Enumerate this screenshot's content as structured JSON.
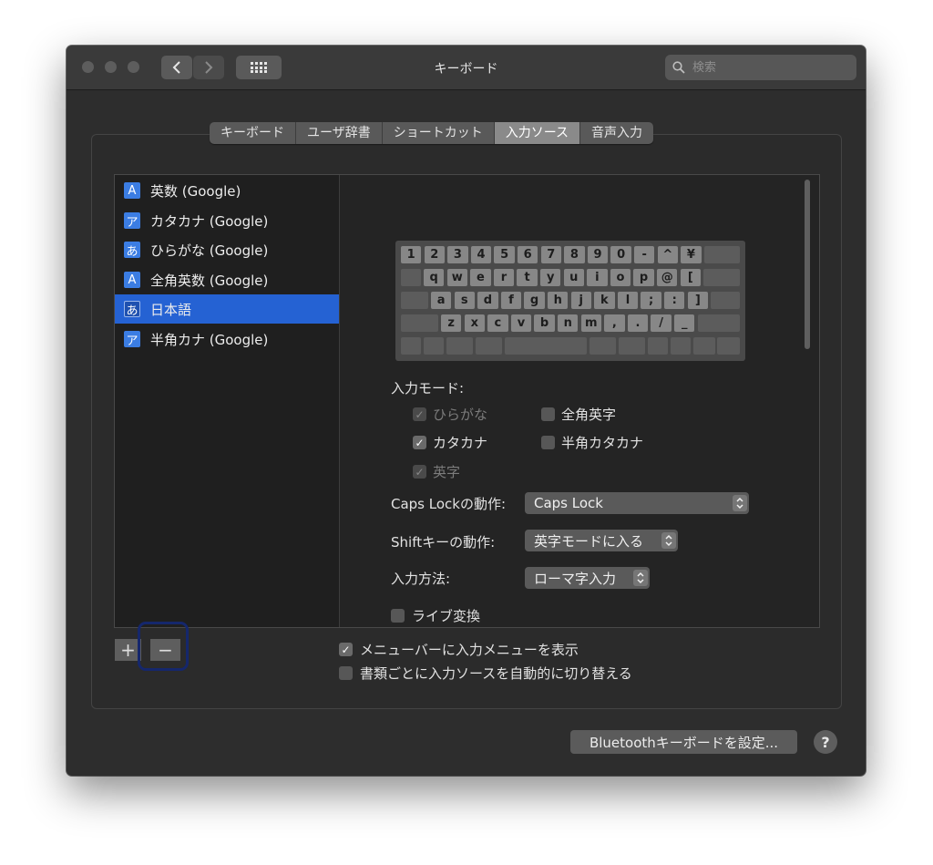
{
  "window": {
    "title": "キーボード",
    "search_placeholder": "検索"
  },
  "tabs": [
    {
      "label": "キーボード",
      "active": false
    },
    {
      "label": "ユーザ辞書",
      "active": false
    },
    {
      "label": "ショートカット",
      "active": false
    },
    {
      "label": "入力ソース",
      "active": true
    },
    {
      "label": "音声入力",
      "active": false
    }
  ],
  "sources": [
    {
      "icon": "A",
      "label": "英数 (Google)",
      "selected": false
    },
    {
      "icon": "ア",
      "label": "カタカナ (Google)",
      "selected": false
    },
    {
      "icon": "あ",
      "label": "ひらがな (Google)",
      "selected": false
    },
    {
      "icon": "A",
      "label": "全角英数 (Google)",
      "selected": false
    },
    {
      "icon": "あ",
      "label": "日本語",
      "selected": true
    },
    {
      "icon": "ア",
      "label": "半角カナ (Google)",
      "selected": false
    }
  ],
  "keyboard_rows": [
    [
      "1",
      "2",
      "3",
      "4",
      "5",
      "6",
      "7",
      "8",
      "9",
      "0",
      "-",
      "^",
      "¥"
    ],
    [
      "q",
      "w",
      "e",
      "r",
      "t",
      "y",
      "u",
      "i",
      "o",
      "p",
      "@",
      "["
    ],
    [
      "a",
      "s",
      "d",
      "f",
      "g",
      "h",
      "j",
      "k",
      "l",
      ";",
      ":",
      "]"
    ],
    [
      "z",
      "x",
      "c",
      "v",
      "b",
      "n",
      "m",
      ",",
      ".",
      "/",
      "_"
    ]
  ],
  "input_modes": {
    "label": "入力モード:",
    "options": [
      {
        "label": "ひらがな",
        "checked": true,
        "disabled": true
      },
      {
        "label": "全角英字",
        "checked": false,
        "disabled": false
      },
      {
        "label": "カタカナ",
        "checked": true,
        "disabled": false
      },
      {
        "label": "半角カタカナ",
        "checked": false,
        "disabled": false
      },
      {
        "label": "英字",
        "checked": true,
        "disabled": true
      }
    ]
  },
  "settings": {
    "caps_lock_label": "Caps Lockの動作:",
    "caps_lock_value": "Caps Lock",
    "shift_label": "Shiftキーの動作:",
    "shift_value": "英字モードに入る",
    "method_label": "入力方法:",
    "method_value": "ローマ字入力",
    "live_conversion": {
      "label": "ライブ変換",
      "checked": false
    }
  },
  "list_buttons": {
    "add": "+",
    "remove": "−"
  },
  "footer": {
    "show_menu": {
      "label": "メニューバーに入力メニューを表示",
      "checked": true
    },
    "auto_switch": {
      "label": "書類ごとに入力ソースを自動的に切り替える",
      "checked": false
    }
  },
  "bluetooth_button": "Bluetoothキーボードを設定...",
  "help_button": "?",
  "colors": {
    "selection": "#2562d3",
    "source_icon": "#3b7de3",
    "window_bg": "#2d2d2d",
    "focus_ring": "#15276c"
  }
}
